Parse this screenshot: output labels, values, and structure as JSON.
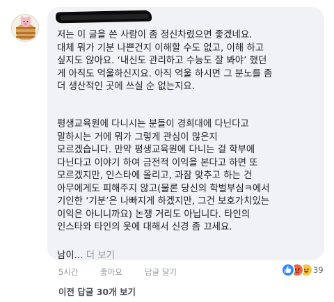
{
  "comment": {
    "paragraph1": [
      "저는 이 글을 쓴 사람이 좀 정신차렸으면 좋겠네요.",
      "대체 뭐가 기분 나쁜건지 이해할 수도 없고, 이해 하고",
      "싶지도 않아요. ‘내신도 관리하고 수능도 잘 봐야’ 했던",
      "게 아직도 억울하신지요. 아직 억울 하시면 그 분노를 좀",
      "더 생산적인 곳에 쓰실 순 없는지요."
    ],
    "paragraph2": [
      "평생교육원에 다니시는 분들이 경희대에 다닌다고",
      "말하시는 거에 뭐가 그렇게 관심이 많은지",
      "모르겠습니다. 만약 평생교육원에 다니는 걸 학부에",
      "다닌다고 이야기 하여 금전적  이익을 본다고 하면 또",
      "모르겠지만, 인스타에 올리고, 과잠 맞추고 하는 건",
      "아무에게도 피해주지 않고(물론 당신의 학벌부심ㅋ에서",
      "기인한 ‘기분’은 나빠지게 하겠지만, 그건 보호가치있는",
      "이익은 아니니까요) 논쟁 거리도 아닙니다. 타인의",
      "인스타와 타인의 옷에 대해서 신경 좀 끄세요."
    ],
    "truncated_line": "남이...",
    "see_more": "더 보기"
  },
  "meta": {
    "time": "5시간",
    "like": "좋아요",
    "reply": "답글 달기",
    "reaction_count": "39",
    "reaction_icons": [
      "like-icon",
      "angry-icon",
      "haha-icon"
    ]
  },
  "previous_replies": "이전 답글 30개 보기"
}
